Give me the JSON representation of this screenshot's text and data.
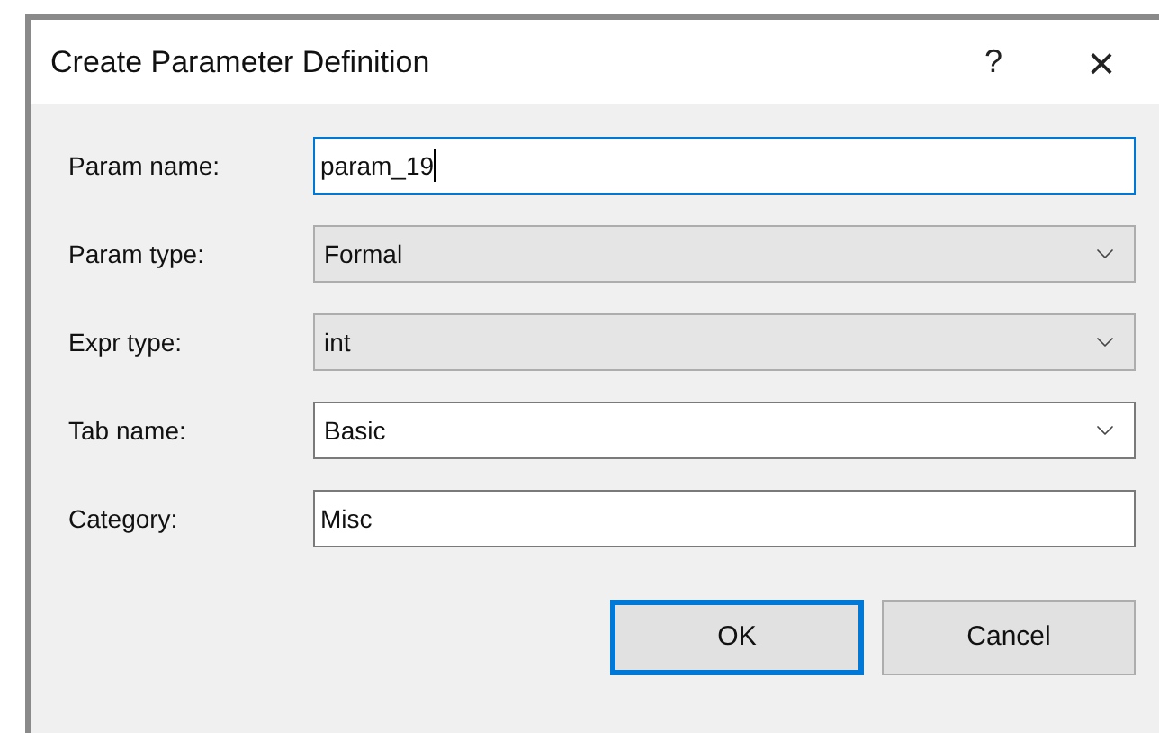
{
  "window": {
    "title": "Create Parameter Definition",
    "help": "?",
    "close": "×"
  },
  "fields": [
    {
      "label": "Param name:",
      "kind": "text",
      "value": "param_19",
      "focused": true
    },
    {
      "label": "Param type:",
      "kind": "dropdown",
      "value": "Formal",
      "focused": false
    },
    {
      "label": "Expr type:",
      "kind": "dropdown",
      "value": "int",
      "focused": false
    },
    {
      "label": "Tab name:",
      "kind": "combo",
      "value": "Basic",
      "focused": false
    },
    {
      "label": "Category:",
      "kind": "text",
      "value": "Misc",
      "focused": false
    }
  ],
  "buttons": [
    {
      "label": "OK",
      "default": true
    },
    {
      "label": "Cancel",
      "default": false
    }
  ]
}
